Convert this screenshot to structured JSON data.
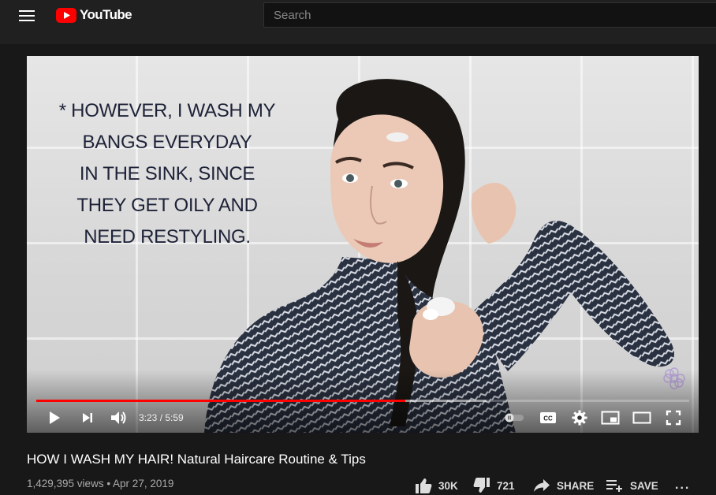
{
  "header": {
    "logo_text": "YouTube",
    "search_placeholder": "Search"
  },
  "video": {
    "overlay_lines": [
      "* HOWEVER, I WASH MY",
      "BANGS EVERYDAY",
      "IN THE SINK, SINCE",
      "THEY GET OILY AND",
      "NEED RESTYLING."
    ],
    "time_display": "3:23 / 5:59",
    "progress_fraction": 0.565,
    "buffered_fraction": 0.69
  },
  "info": {
    "title": "HOW I WASH MY HAIR! Natural Haircare Routine & Tips",
    "views_date": "1,429,395 views • Apr 27, 2019",
    "likes": "30K",
    "dislikes": "721",
    "share_label": "SHARE",
    "save_label": "SAVE",
    "more_label": "..."
  },
  "colors": {
    "brand_red": "#ff0000",
    "background": "#181818",
    "header": "#202020"
  }
}
